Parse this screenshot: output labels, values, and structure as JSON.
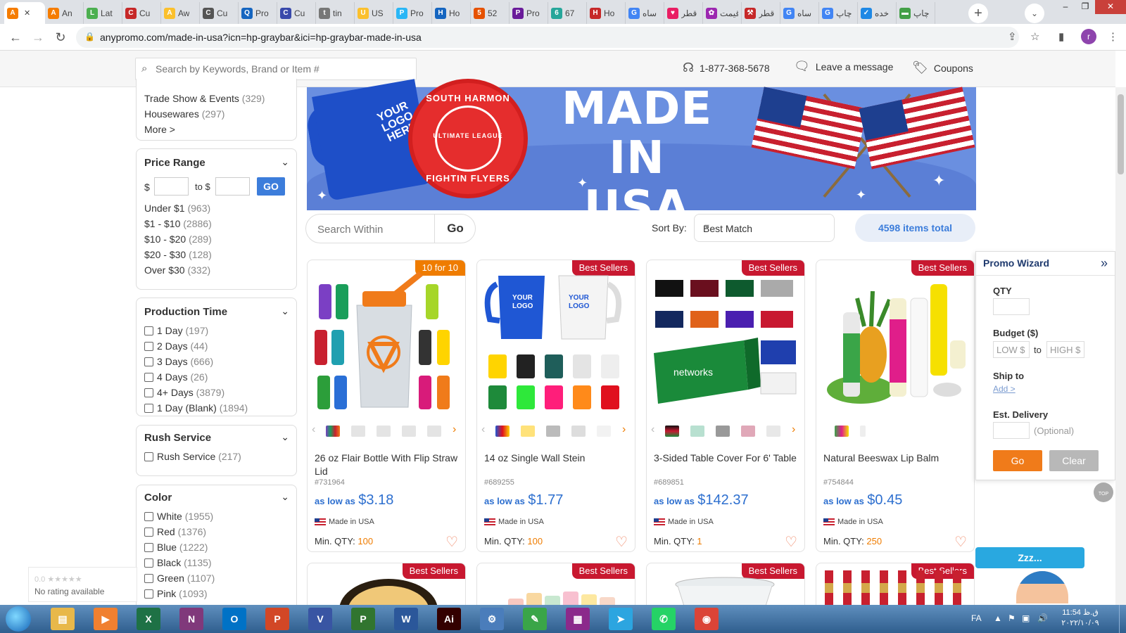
{
  "browser": {
    "tabs": [
      {
        "label": "",
        "fav": "A",
        "color": "#f57c00",
        "active": true
      },
      {
        "label": "An",
        "fav": "A",
        "color": "#f57c00"
      },
      {
        "label": "Lat",
        "fav": "L",
        "color": "#4caf50"
      },
      {
        "label": "Cu",
        "fav": "C",
        "color": "#c62828"
      },
      {
        "label": "Aw",
        "fav": "A",
        "color": "#fbc02d"
      },
      {
        "label": "Cu",
        "fav": "C",
        "color": "#555555"
      },
      {
        "label": "Pro",
        "fav": "Q",
        "color": "#1565c0"
      },
      {
        "label": "Cu",
        "fav": "C",
        "color": "#3949ab"
      },
      {
        "label": "tin",
        "fav": "t",
        "color": "#777777"
      },
      {
        "label": "US",
        "fav": "U",
        "color": "#fbc02d"
      },
      {
        "label": "Pro",
        "fav": "P",
        "color": "#29b6f6"
      },
      {
        "label": "Ho",
        "fav": "H",
        "color": "#1565c0"
      },
      {
        "label": "52",
        "fav": "5",
        "color": "#e65100"
      },
      {
        "label": "Pro",
        "fav": "P",
        "color": "#6a1b9a"
      },
      {
        "label": "67",
        "fav": "6",
        "color": "#26a69a"
      },
      {
        "label": "Ho",
        "fav": "H",
        "color": "#c62828"
      },
      {
        "label": "ساه",
        "fav": "G",
        "color": "#4285f4"
      },
      {
        "label": "قطر",
        "fav": "♥",
        "color": "#e91e63"
      },
      {
        "label": "قیمت",
        "fav": "✿",
        "color": "#9c27b0"
      },
      {
        "label": "قطر",
        "fav": "⚒",
        "color": "#c62828"
      },
      {
        "label": "ساه",
        "fav": "G",
        "color": "#4285f4"
      },
      {
        "label": "چاپ",
        "fav": "G",
        "color": "#4285f4"
      },
      {
        "label": "خده",
        "fav": "✓",
        "color": "#1e88e5"
      },
      {
        "label": "چاپ",
        "fav": "▬",
        "color": "#43a047"
      }
    ],
    "new_tab": "+",
    "tab_menu": "⌄",
    "url": "anypromo.com/made-in-usa?icn=hp-graybar&ici=hp-graybar-made-in-usa",
    "profile_initial": "r"
  },
  "header": {
    "search_placeholder": "Search by Keywords, Brand or Item #",
    "phone": "1-877-368-5678",
    "message": "Leave a message",
    "coupons": "Coupons"
  },
  "sidebar": {
    "category_items": [
      {
        "label": "Trade Show & Events",
        "count": "(329)"
      },
      {
        "label": "Housewares",
        "count": "(297)"
      }
    ],
    "more": "More >",
    "price": {
      "title": "Price Range",
      "dollar": "$",
      "to": "to $",
      "go": "GO",
      "items": [
        {
          "label": "Under $1",
          "count": "(963)"
        },
        {
          "label": "$1 - $10",
          "count": "(2886)"
        },
        {
          "label": "$10 - $20",
          "count": "(289)"
        },
        {
          "label": "$20 - $30",
          "count": "(128)"
        },
        {
          "label": "Over $30",
          "count": "(332)"
        }
      ]
    },
    "production": {
      "title": "Production Time",
      "items": [
        {
          "label": "1 Day",
          "count": "(197)"
        },
        {
          "label": "2 Days",
          "count": "(44)"
        },
        {
          "label": "3 Days",
          "count": "(666)"
        },
        {
          "label": "4 Days",
          "count": "(26)"
        },
        {
          "label": "4+ Days",
          "count": "(3879)"
        },
        {
          "label": "1 Day (Blank)",
          "count": "(1894)"
        }
      ]
    },
    "rush": {
      "title": "Rush Service",
      "items": [
        {
          "label": "Rush Service",
          "count": "(217)"
        }
      ]
    },
    "color": {
      "title": "Color",
      "items": [
        {
          "label": "White",
          "count": "(1955)"
        },
        {
          "label": "Red",
          "count": "(1376)"
        },
        {
          "label": "Blue",
          "count": "(1222)"
        },
        {
          "label": "Black",
          "count": "(1135)"
        },
        {
          "label": "Green",
          "count": "(1107)"
        },
        {
          "label": "Pink",
          "count": "(1093)"
        }
      ]
    }
  },
  "banner": {
    "headline_line1": "MADE IN",
    "headline_line2": "USA",
    "mug_text": "YOUR LOGO HERE",
    "frisbee_top": "SOUTH HARMON",
    "frisbee_bottom": "FIGHTIN FLYERS",
    "frisbee_center": "ULTIMATE LEAGUE"
  },
  "toolbar": {
    "search_within_placeholder": "Search Within",
    "go": "Go",
    "sort_label": "Sort By:",
    "sort_value": "Best Match",
    "total": "4598 items total"
  },
  "products": [
    {
      "badge": "10 for 10",
      "badge_color": "orange",
      "name": "26 oz Flair Bottle With Flip Straw Lid",
      "sku": "#731964",
      "as_low_as": "as low as",
      "price": "$3.18",
      "made": "Made in USA",
      "minqty_label": "Min. QTY:",
      "minqty": "100"
    },
    {
      "badge": "Best Sellers",
      "badge_color": "red",
      "name": "14 oz Single Wall Stein",
      "sku": "#689255",
      "as_low_as": "as low as",
      "price": "$1.77",
      "made": "Made in USA",
      "minqty_label": "Min. QTY:",
      "minqty": "100"
    },
    {
      "badge": "Best Sellers",
      "badge_color": "red",
      "name": "3-Sided Table Cover For 6' Table",
      "sku": "#689851",
      "as_low_as": "as low as",
      "price": "$142.37",
      "made": "Made in USA",
      "minqty_label": "Min. QTY:",
      "minqty": "1"
    },
    {
      "badge": "Best Sellers",
      "badge_color": "red",
      "name": "Natural Beeswax Lip Balm",
      "sku": "#754844",
      "as_low_as": "as low as",
      "price": "$0.45",
      "made": "Made in USA",
      "minqty_label": "Min. QTY:",
      "minqty": "250"
    }
  ],
  "products_row2": [
    {
      "badge": "Best Sellers"
    },
    {
      "badge": "Best Sellers"
    },
    {
      "badge": "Best Sellers"
    },
    {
      "badge": "Best Sellers"
    }
  ],
  "wizard": {
    "title": "Promo Wizard",
    "collapse": "»",
    "qty": "QTY",
    "budget": "Budget ($)",
    "low": "LOW $",
    "to": "to",
    "high": "HIGH $",
    "ship_to": "Ship to",
    "add": "Add >",
    "est_delivery": "Est. Delivery",
    "optional": "(Optional)",
    "go": "Go",
    "clear": "Clear"
  },
  "top_button": "TOP",
  "chat": {
    "bubble": "Zzz..."
  },
  "rating": {
    "stars": "0.0 ★★★★★",
    "text": "No rating available"
  },
  "taskbar": {
    "apps": [
      {
        "name": "explorer",
        "glyph": "▤",
        "color": "#e8b84a"
      },
      {
        "name": "media",
        "glyph": "▶",
        "color": "#f08030"
      },
      {
        "name": "excel",
        "glyph": "X",
        "color": "#1e7145"
      },
      {
        "name": "onenote",
        "glyph": "N",
        "color": "#80397b"
      },
      {
        "name": "outlook",
        "glyph": "O",
        "color": "#0072c6"
      },
      {
        "name": "powerpoint",
        "glyph": "P",
        "color": "#d24726"
      },
      {
        "name": "visio",
        "glyph": "V",
        "color": "#3955a3"
      },
      {
        "name": "project",
        "glyph": "P",
        "color": "#31752f"
      },
      {
        "name": "word",
        "glyph": "W",
        "color": "#2b579a"
      },
      {
        "name": "illustrator",
        "glyph": "Ai",
        "color": "#330000"
      },
      {
        "name": "control",
        "glyph": "⚙",
        "color": "#4a7dbb"
      },
      {
        "name": "feather",
        "glyph": "✎",
        "color": "#3aa548"
      },
      {
        "name": "winrar",
        "glyph": "▦",
        "color": "#8b2a8b"
      },
      {
        "name": "telegram",
        "glyph": "➤",
        "color": "#2ca5e0"
      },
      {
        "name": "whatsapp",
        "glyph": "✆",
        "color": "#25d366"
      },
      {
        "name": "chrome",
        "glyph": "◉",
        "color": "#db4437"
      }
    ],
    "lang": "FA",
    "time": "ق.ظ 11:54",
    "date": "۲۰۲۲/۱۰/۰۹"
  }
}
